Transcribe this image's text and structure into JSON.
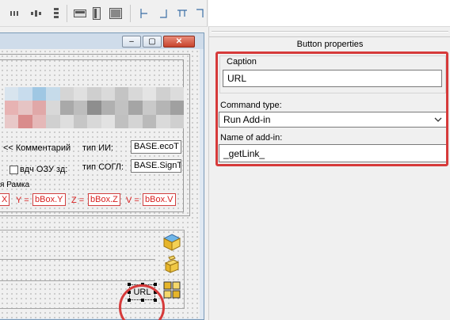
{
  "toolbar": {
    "icons": [
      "align-left-icon",
      "align-center-icon",
      "align-vertical-icon",
      "size-width-icon",
      "size-height-icon",
      "size-both-icon",
      "anchor-left-icon",
      "anchor-bottom-left-icon",
      "anchor-top-icon",
      "anchor-right-icon"
    ]
  },
  "form": {
    "window_buttons": {
      "minimize": "–",
      "maximize": "▢",
      "close": "✕"
    },
    "comment_label": "<< Комментарий",
    "ii_type_label": "тип ИИ:",
    "ii_type_value": "BASE.ecoT",
    "ozu_label": "вдч ОЗУ зд:",
    "sogl_type_label": "тип СОГЛ:",
    "sogl_type_value": "BASE.SignT",
    "frame_label": "я Рамка",
    "coord_fields": [
      {
        "label": "",
        "value": "X"
      },
      {
        "label": "Y =",
        "value": "bBox.Y"
      },
      {
        "label": "Z =",
        "value": "bBox.Z"
      },
      {
        "label": "V =",
        "value": "bBox.V"
      }
    ],
    "url_button_caption": "URL",
    "side_icons": [
      "cube-icon",
      "extrude-icon",
      "layout-grid-icon"
    ]
  },
  "properties": {
    "header": "Button properties",
    "caption_label": "Caption",
    "caption_value": "URL",
    "command_type_label": "Command type:",
    "command_type_value": "Run Add-in",
    "addin_name_label": "Name of add-in:",
    "addin_name_value": "_getLink_"
  },
  "colors": {
    "highlight": "#d63a3a",
    "field_red": "#d82020"
  }
}
